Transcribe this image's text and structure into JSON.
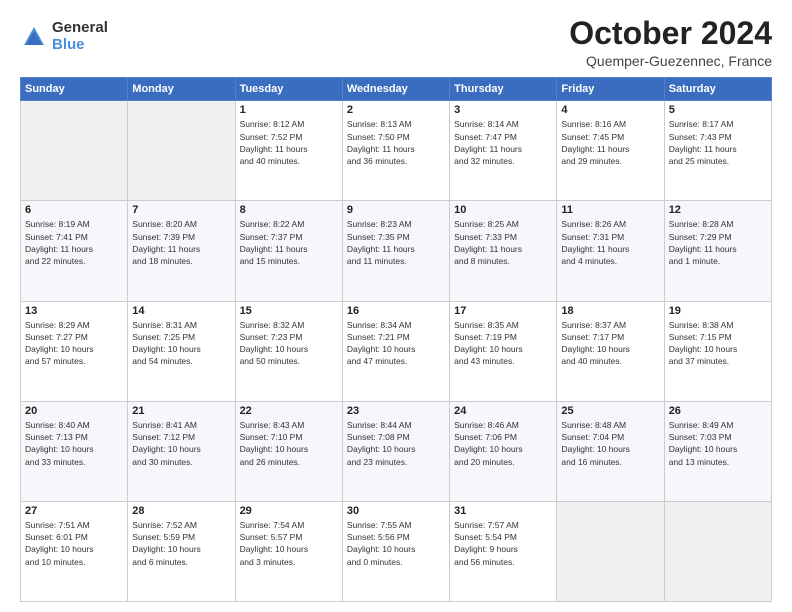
{
  "header": {
    "logo_general": "General",
    "logo_blue": "Blue",
    "month_title": "October 2024",
    "location": "Quemper-Guezennec, France"
  },
  "days_of_week": [
    "Sunday",
    "Monday",
    "Tuesday",
    "Wednesday",
    "Thursday",
    "Friday",
    "Saturday"
  ],
  "weeks": [
    [
      {
        "day": "",
        "info": ""
      },
      {
        "day": "",
        "info": ""
      },
      {
        "day": "1",
        "info": "Sunrise: 8:12 AM\nSunset: 7:52 PM\nDaylight: 11 hours\nand 40 minutes."
      },
      {
        "day": "2",
        "info": "Sunrise: 8:13 AM\nSunset: 7:50 PM\nDaylight: 11 hours\nand 36 minutes."
      },
      {
        "day": "3",
        "info": "Sunrise: 8:14 AM\nSunset: 7:47 PM\nDaylight: 11 hours\nand 32 minutes."
      },
      {
        "day": "4",
        "info": "Sunrise: 8:16 AM\nSunset: 7:45 PM\nDaylight: 11 hours\nand 29 minutes."
      },
      {
        "day": "5",
        "info": "Sunrise: 8:17 AM\nSunset: 7:43 PM\nDaylight: 11 hours\nand 25 minutes."
      }
    ],
    [
      {
        "day": "6",
        "info": "Sunrise: 8:19 AM\nSunset: 7:41 PM\nDaylight: 11 hours\nand 22 minutes."
      },
      {
        "day": "7",
        "info": "Sunrise: 8:20 AM\nSunset: 7:39 PM\nDaylight: 11 hours\nand 18 minutes."
      },
      {
        "day": "8",
        "info": "Sunrise: 8:22 AM\nSunset: 7:37 PM\nDaylight: 11 hours\nand 15 minutes."
      },
      {
        "day": "9",
        "info": "Sunrise: 8:23 AM\nSunset: 7:35 PM\nDaylight: 11 hours\nand 11 minutes."
      },
      {
        "day": "10",
        "info": "Sunrise: 8:25 AM\nSunset: 7:33 PM\nDaylight: 11 hours\nand 8 minutes."
      },
      {
        "day": "11",
        "info": "Sunrise: 8:26 AM\nSunset: 7:31 PM\nDaylight: 11 hours\nand 4 minutes."
      },
      {
        "day": "12",
        "info": "Sunrise: 8:28 AM\nSunset: 7:29 PM\nDaylight: 11 hours\nand 1 minute."
      }
    ],
    [
      {
        "day": "13",
        "info": "Sunrise: 8:29 AM\nSunset: 7:27 PM\nDaylight: 10 hours\nand 57 minutes."
      },
      {
        "day": "14",
        "info": "Sunrise: 8:31 AM\nSunset: 7:25 PM\nDaylight: 10 hours\nand 54 minutes."
      },
      {
        "day": "15",
        "info": "Sunrise: 8:32 AM\nSunset: 7:23 PM\nDaylight: 10 hours\nand 50 minutes."
      },
      {
        "day": "16",
        "info": "Sunrise: 8:34 AM\nSunset: 7:21 PM\nDaylight: 10 hours\nand 47 minutes."
      },
      {
        "day": "17",
        "info": "Sunrise: 8:35 AM\nSunset: 7:19 PM\nDaylight: 10 hours\nand 43 minutes."
      },
      {
        "day": "18",
        "info": "Sunrise: 8:37 AM\nSunset: 7:17 PM\nDaylight: 10 hours\nand 40 minutes."
      },
      {
        "day": "19",
        "info": "Sunrise: 8:38 AM\nSunset: 7:15 PM\nDaylight: 10 hours\nand 37 minutes."
      }
    ],
    [
      {
        "day": "20",
        "info": "Sunrise: 8:40 AM\nSunset: 7:13 PM\nDaylight: 10 hours\nand 33 minutes."
      },
      {
        "day": "21",
        "info": "Sunrise: 8:41 AM\nSunset: 7:12 PM\nDaylight: 10 hours\nand 30 minutes."
      },
      {
        "day": "22",
        "info": "Sunrise: 8:43 AM\nSunset: 7:10 PM\nDaylight: 10 hours\nand 26 minutes."
      },
      {
        "day": "23",
        "info": "Sunrise: 8:44 AM\nSunset: 7:08 PM\nDaylight: 10 hours\nand 23 minutes."
      },
      {
        "day": "24",
        "info": "Sunrise: 8:46 AM\nSunset: 7:06 PM\nDaylight: 10 hours\nand 20 minutes."
      },
      {
        "day": "25",
        "info": "Sunrise: 8:48 AM\nSunset: 7:04 PM\nDaylight: 10 hours\nand 16 minutes."
      },
      {
        "day": "26",
        "info": "Sunrise: 8:49 AM\nSunset: 7:03 PM\nDaylight: 10 hours\nand 13 minutes."
      }
    ],
    [
      {
        "day": "27",
        "info": "Sunrise: 7:51 AM\nSunset: 6:01 PM\nDaylight: 10 hours\nand 10 minutes."
      },
      {
        "day": "28",
        "info": "Sunrise: 7:52 AM\nSunset: 5:59 PM\nDaylight: 10 hours\nand 6 minutes."
      },
      {
        "day": "29",
        "info": "Sunrise: 7:54 AM\nSunset: 5:57 PM\nDaylight: 10 hours\nand 3 minutes."
      },
      {
        "day": "30",
        "info": "Sunrise: 7:55 AM\nSunset: 5:56 PM\nDaylight: 10 hours\nand 0 minutes."
      },
      {
        "day": "31",
        "info": "Sunrise: 7:57 AM\nSunset: 5:54 PM\nDaylight: 9 hours\nand 56 minutes."
      },
      {
        "day": "",
        "info": ""
      },
      {
        "day": "",
        "info": ""
      }
    ]
  ]
}
